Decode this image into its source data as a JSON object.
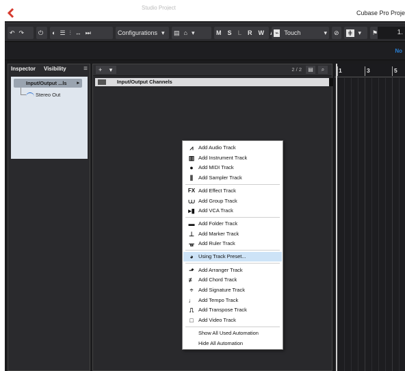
{
  "app": {
    "title": "Cubase Pro Proje",
    "menu_ghost": "Studio   Project"
  },
  "toolbar": {
    "configurations_label": "Configurations",
    "automation_mode": "Touch",
    "letters": [
      "M",
      "S",
      "L",
      "R",
      "W",
      "A"
    ],
    "counter": "1."
  },
  "infoline": {
    "right_text": "No"
  },
  "inspector": {
    "tab_inspector": "Inspector",
    "tab_visibility": "Visibility",
    "menu_icon": "≡",
    "channel_button": "Input/Output ...ls",
    "output_label": "Stereo Out"
  },
  "tracklist": {
    "add_button": "+",
    "count": "2 / 2",
    "track_name": "Input/Output Channels"
  },
  "ruler": {
    "numbers": [
      "1",
      "3",
      "5"
    ]
  },
  "context_menu": {
    "items": [
      {
        "label": "Add Audio Track",
        "icon": "audio-wave-icon"
      },
      {
        "label": "Add Instrument Track",
        "icon": "piano-keys-icon"
      },
      {
        "label": "Add MIDI Track",
        "icon": "midi-plug-icon"
      },
      {
        "label": "Add Sampler Track",
        "icon": "sampler-icon"
      },
      {
        "label": "Add Effect Track",
        "icon": "fx-icon"
      },
      {
        "label": "Add Group Track",
        "icon": "group-icon"
      },
      {
        "label": "Add VCA Track",
        "icon": "vca-icon"
      },
      {
        "label": "Add Folder Track",
        "icon": "folder-icon"
      },
      {
        "label": "Add Marker Track",
        "icon": "marker-icon"
      },
      {
        "label": "Add Ruler Track",
        "icon": "ruler-icon"
      },
      {
        "label": "Using Track Preset...",
        "icon": "track-preset-icon"
      },
      {
        "label": "Add Arranger Track",
        "icon": "arranger-icon"
      },
      {
        "label": "Add Chord Track",
        "icon": "chord-icon"
      },
      {
        "label": "Add Signature Track",
        "icon": "signature-icon"
      },
      {
        "label": "Add Tempo Track",
        "icon": "tempo-icon"
      },
      {
        "label": "Add Transpose Track",
        "icon": "transpose-icon"
      },
      {
        "label": "Add Video Track",
        "icon": "video-icon"
      },
      {
        "label": "Show All Used Automation",
        "icon": ""
      },
      {
        "label": "Hide All Automation",
        "icon": ""
      }
    ],
    "highlighted_index": 10
  },
  "colors": {
    "app_bg": "#1b1b1d",
    "logo_red": "#d63a2e",
    "accent_blue": "#2a7fd4",
    "menu_highlight": "#cde3f7"
  }
}
